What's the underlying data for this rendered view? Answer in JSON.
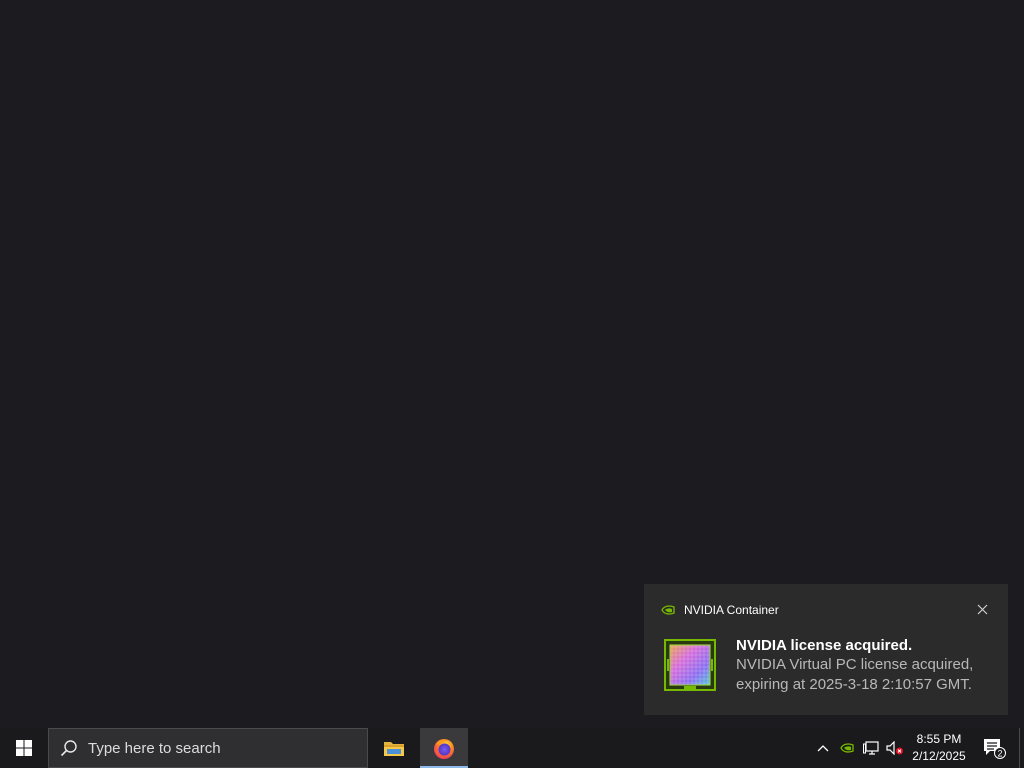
{
  "notification": {
    "app_icon": "nvidia-logo-icon",
    "app_name": "NVIDIA Container",
    "close_icon": "close-icon",
    "image": "nvidia-gpu-chip-image",
    "title": "NVIDIA license acquired.",
    "body": "NVIDIA Virtual PC license acquired, expiring at 2025-3-18 2:10:57 GMT."
  },
  "taskbar": {
    "start_icon": "windows-logo-icon",
    "search": {
      "icon": "search-icon",
      "placeholder": "Type here to search"
    },
    "apps": [
      {
        "name": "File Explorer",
        "icon": "folder-icon",
        "active": false
      },
      {
        "name": "Firefox",
        "icon": "firefox-icon",
        "active": true
      }
    ],
    "tray": {
      "overflow_icon": "chevron-up-icon",
      "nvidia_icon": "nvidia-tray-icon",
      "network_icon": "network-monitor-icon",
      "volume_icon": "volume-muted-icon",
      "time": "8:55 PM",
      "date": "2/12/2025",
      "notification_count": "2"
    }
  },
  "colors": {
    "desktop": "#1c1b20",
    "taskbar": "#1a1a1d",
    "toast_bg": "#2b2b2b",
    "nvidia_green": "#76b900",
    "accent": "#8eb8e8"
  }
}
